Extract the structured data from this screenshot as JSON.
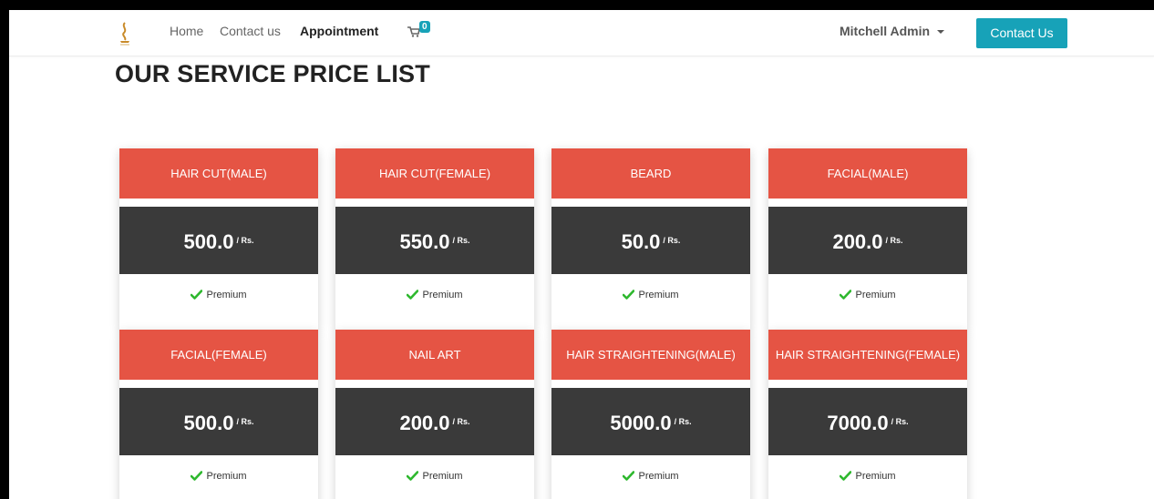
{
  "nav": {
    "links": [
      {
        "label": "Home"
      },
      {
        "label": "Contact us"
      },
      {
        "label": "Appointment"
      }
    ],
    "cart_count": "0",
    "user": "Mitchell Admin",
    "cta": "Contact Us"
  },
  "page": {
    "title": "OUR SERVICE PRICE LIST"
  },
  "services": [
    {
      "name": "HAIR CUT(MALE)",
      "price": "500.0",
      "unit": "/ Rs.",
      "feature": "Premium"
    },
    {
      "name": "HAIR CUT(FEMALE)",
      "price": "550.0",
      "unit": "/ Rs.",
      "feature": "Premium"
    },
    {
      "name": "BEARD",
      "price": "50.0",
      "unit": "/ Rs.",
      "feature": "Premium"
    },
    {
      "name": "FACIAL(MALE)",
      "price": "200.0",
      "unit": "/ Rs.",
      "feature": "Premium"
    },
    {
      "name": "FACIAL(FEMALE)",
      "price": "500.0",
      "unit": "/ Rs.",
      "feature": "Premium"
    },
    {
      "name": "NAIL ART",
      "price": "200.0",
      "unit": "/ Rs.",
      "feature": "Premium"
    },
    {
      "name": "HAIR STRAIGHTENING(MALE)",
      "price": "5000.0",
      "unit": "/ Rs.",
      "feature": "Premium"
    },
    {
      "name": "HAIR STRAIGHTENING(FEMALE)",
      "price": "7000.0",
      "unit": "/ Rs.",
      "feature": "Premium"
    }
  ],
  "colors": {
    "card_header": "#e55444",
    "price_band": "#3a3a3a",
    "accent": "#17a2b8",
    "check": "#2eb82e"
  }
}
